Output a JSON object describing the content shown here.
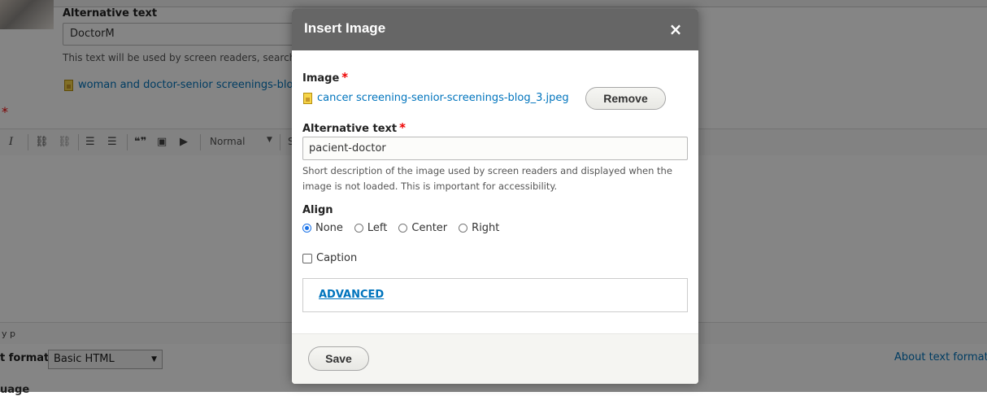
{
  "background": {
    "alt_label": "Alternative text",
    "alt_value": "DoctorM",
    "alt_desc": "This text will be used by screen readers, search",
    "file_name": "woman and doctor-senior screenings-blo",
    "required_star": "*",
    "toolbar": {
      "italic": "I",
      "link": "⛓",
      "unlink": "⛓",
      "bullet_list": "☰",
      "numbered_list": "☰",
      "blockquote": "❝❞",
      "image": "▣",
      "media": "▶",
      "format_value": "Normal",
      "styles_fragment": "S"
    },
    "path": "y  p",
    "text_format_label": "t format",
    "text_format_value": "Basic HTML",
    "about_link": "About text format",
    "language_label": "uage"
  },
  "modal": {
    "title": "Insert Image",
    "close_symbol": "×",
    "image_label": "Image",
    "required_star": "*",
    "image_file": "cancer screening-senior-screenings-blog_3.jpeg",
    "remove_button": "Remove",
    "alt_label": "Alternative text",
    "alt_value": "pacient-doctor",
    "alt_description": "Short description of the image used by screen readers and displayed when the image is not loaded. This is important for accessibility.",
    "align_label": "Align",
    "align_options": [
      "None",
      "Left",
      "Center",
      "Right"
    ],
    "align_selected": "None",
    "caption_label": "Caption",
    "caption_checked": false,
    "advanced_label": "ADVANCED",
    "save_button": "Save"
  },
  "colors": {
    "modal_header": "#666666",
    "link": "#0074bd",
    "required": "#ee0000",
    "overlay": "rgba(0,0,0,0.48)"
  },
  "icons": [
    "close-icon",
    "file-image-icon",
    "italic-icon",
    "link-icon",
    "unlink-icon",
    "bullet-list-icon",
    "numbered-list-icon",
    "blockquote-icon",
    "image-icon",
    "media-icon"
  ]
}
